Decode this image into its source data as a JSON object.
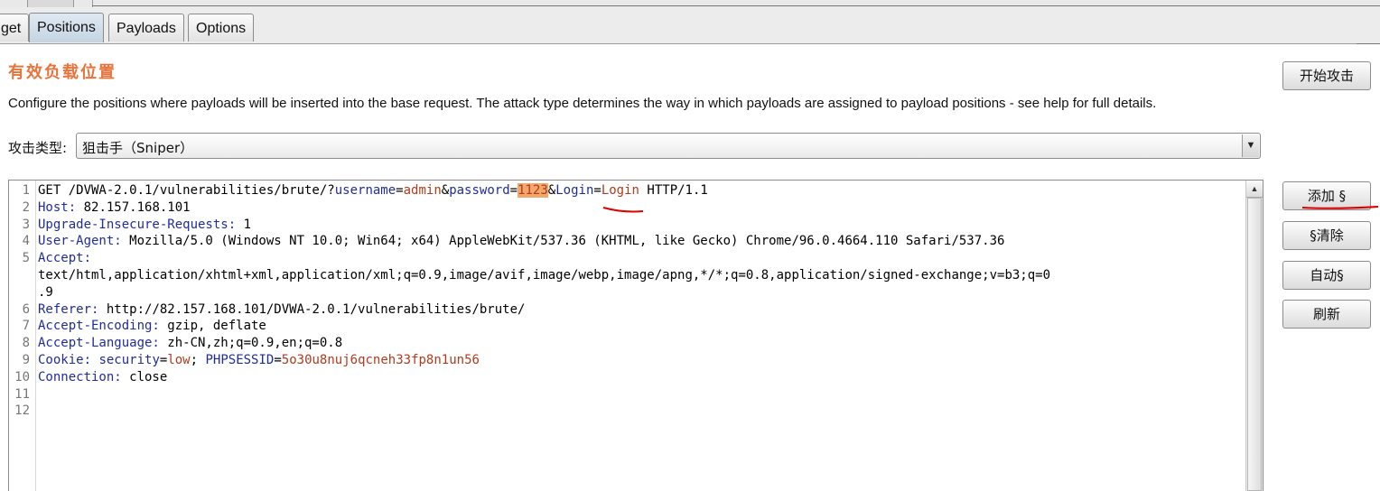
{
  "tabs": [
    {
      "label": "get"
    },
    {
      "label": "Positions"
    },
    {
      "label": "Payloads"
    },
    {
      "label": "Options"
    }
  ],
  "section_title": "有效负载位置",
  "description": "Configure the positions where payloads will be inserted into the base request. The attack type determines the way in which payloads are assigned to payload positions - see help for full details.",
  "start_attack_label": "开始攻击",
  "attack_type": {
    "label": "攻击类型:",
    "value": "狙击手（Sniper）"
  },
  "side_buttons": {
    "add": "添加 §",
    "clear": "§清除",
    "auto": "自动§",
    "refresh": "刷新"
  },
  "request_lines": [
    [
      {
        "t": "GET /DVWA-2.0.1/vulnerabilities/brute/?",
        "c": "v"
      },
      {
        "t": "username",
        "c": "k"
      },
      {
        "t": "=",
        "c": "v"
      },
      {
        "t": "admin",
        "c": "p"
      },
      {
        "t": "&",
        "c": "v"
      },
      {
        "t": "password",
        "c": "k"
      },
      {
        "t": "=",
        "c": "v"
      },
      {
        "t": "1123",
        "c": "hl"
      },
      {
        "t": "&",
        "c": "v"
      },
      {
        "t": "Login",
        "c": "k"
      },
      {
        "t": "=",
        "c": "v"
      },
      {
        "t": "Login",
        "c": "p"
      },
      {
        "t": " HTTP/1.1",
        "c": "v"
      }
    ],
    [
      {
        "t": "Host:",
        "c": "k"
      },
      {
        "t": " 82.157.168.101",
        "c": "v"
      }
    ],
    [
      {
        "t": "Upgrade-Insecure-Requests:",
        "c": "k"
      },
      {
        "t": " 1",
        "c": "v"
      }
    ],
    [
      {
        "t": "User-Agent:",
        "c": "k"
      },
      {
        "t": " Mozilla/5.0 (Windows NT 10.0; Win64; x64) AppleWebKit/537.36 (KHTML, like Gecko) Chrome/96.0.4664.110 Safari/537.36",
        "c": "v"
      }
    ],
    [
      {
        "t": "Accept:",
        "c": "k"
      }
    ],
    [
      {
        "t": "text/html,application/xhtml+xml,application/xml;q=0.9,image/avif,image/webp,image/apng,*/*;q=0.8,application/signed-exchange;v=b3;q=0",
        "c": "v"
      }
    ],
    [
      {
        "t": ".9",
        "c": "v"
      }
    ],
    [
      {
        "t": "Referer:",
        "c": "k"
      },
      {
        "t": " http://82.157.168.101/DVWA-2.0.1/vulnerabilities/brute/",
        "c": "v"
      }
    ],
    [
      {
        "t": "Accept-Encoding:",
        "c": "k"
      },
      {
        "t": " gzip, deflate",
        "c": "v"
      }
    ],
    [
      {
        "t": "Accept-Language:",
        "c": "k"
      },
      {
        "t": " zh-CN,zh;q=0.9,en;q=0.8",
        "c": "v"
      }
    ],
    [
      {
        "t": "Cookie:",
        "c": "k"
      },
      {
        "t": " ",
        "c": "v"
      },
      {
        "t": "security",
        "c": "k"
      },
      {
        "t": "=",
        "c": "v"
      },
      {
        "t": "low",
        "c": "p"
      },
      {
        "t": "; ",
        "c": "v"
      },
      {
        "t": "PHPSESSID",
        "c": "k"
      },
      {
        "t": "=",
        "c": "v"
      },
      {
        "t": "5o30u8nuj6qcneh33fp8n1un56",
        "c": "p"
      }
    ],
    [
      {
        "t": "Connection:",
        "c": "k"
      },
      {
        "t": " close",
        "c": "v"
      }
    ],
    [],
    []
  ],
  "line_numbers": [
    "1",
    "2",
    "3",
    "4",
    "5",
    "",
    "",
    "6",
    "7",
    "8",
    "9",
    "10",
    "11",
    "12"
  ]
}
